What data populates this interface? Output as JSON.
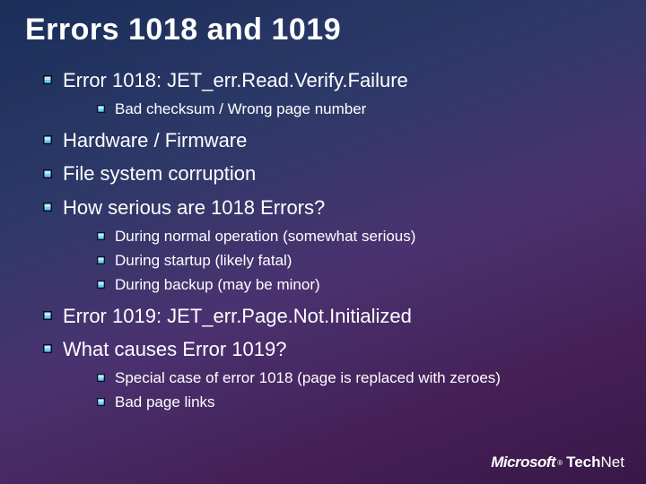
{
  "title": "Errors 1018 and 1019",
  "items": [
    {
      "text": "Error 1018:  JET_err.Read.Verify.Failure",
      "sub": [
        {
          "text": "Bad checksum / Wrong page number"
        }
      ]
    },
    {
      "text": "Hardware / Firmware"
    },
    {
      "text": "File system corruption"
    },
    {
      "text": "How serious are 1018 Errors?",
      "sub": [
        {
          "text": "During normal operation (somewhat serious)"
        },
        {
          "text": "During startup (likely fatal)"
        },
        {
          "text": "During backup (may be minor)"
        }
      ]
    },
    {
      "text": "Error 1019:  JET_err.Page.Not.Initialized"
    },
    {
      "text": "What causes Error 1019?",
      "sub": [
        {
          "text": "Special case of error 1018 (page is replaced with zeroes)"
        },
        {
          "text": "Bad page links"
        }
      ]
    }
  ],
  "footer": {
    "ms": "Microsoft",
    "reg": "®",
    "tech": "Tech",
    "net": "Net"
  }
}
